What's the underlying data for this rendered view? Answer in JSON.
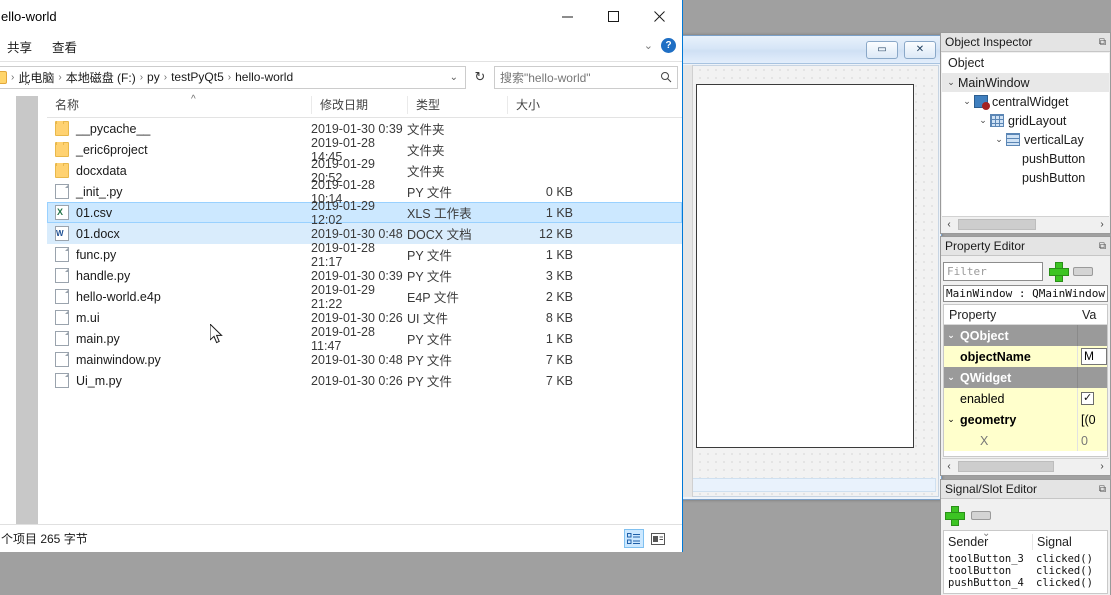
{
  "explorer": {
    "title": "hello-world",
    "title_clipped": "ello-world",
    "window_controls": {
      "minimize": "minimize-icon",
      "maximize": "maximize-icon",
      "close": "close-icon"
    },
    "ribbon_tabs": [
      "共享",
      "查看"
    ],
    "ribbon_expand": "chevron-down-icon",
    "help": "?",
    "address": {
      "breadcrumbs": [
        "此电脑",
        "本地磁盘 (F:)",
        "py",
        "testPyQt5",
        "hello-world"
      ],
      "separator": "›",
      "dropdown": "chevron-down-icon",
      "refresh": "↻"
    },
    "search": {
      "placeholder": "搜索\"hello-world\"",
      "icon": "search-icon"
    },
    "columns": [
      "名称",
      "修改日期",
      "类型",
      "大小"
    ],
    "sort_indicator": "^",
    "files": [
      {
        "name": "__pycache__",
        "icon": "folder",
        "date": "2019-01-30 0:39",
        "type": "文件夹",
        "size": "",
        "state": ""
      },
      {
        "name": "_eric6project",
        "icon": "folder",
        "date": "2019-01-28 14:45",
        "type": "文件夹",
        "size": "",
        "state": ""
      },
      {
        "name": "docxdata",
        "icon": "folder",
        "date": "2019-01-29 20:52",
        "type": "文件夹",
        "size": "",
        "state": ""
      },
      {
        "name": "_init_.py",
        "icon": "file",
        "date": "2019-01-28 10:14",
        "type": "PY 文件",
        "size": "0 KB",
        "state": ""
      },
      {
        "name": "01.csv",
        "icon": "xls",
        "date": "2019-01-29 12:02",
        "type": "XLS 工作表",
        "size": "1 KB",
        "state": "selected"
      },
      {
        "name": "01.docx",
        "icon": "docx",
        "date": "2019-01-30 0:48",
        "type": "DOCX 文档",
        "size": "12 KB",
        "state": "hover"
      },
      {
        "name": "func.py",
        "icon": "file",
        "date": "2019-01-28 21:17",
        "type": "PY 文件",
        "size": "1 KB",
        "state": ""
      },
      {
        "name": "handle.py",
        "icon": "file",
        "date": "2019-01-30 0:39",
        "type": "PY 文件",
        "size": "3 KB",
        "state": ""
      },
      {
        "name": "hello-world.e4p",
        "icon": "file",
        "date": "2019-01-29 21:22",
        "type": "E4P 文件",
        "size": "2 KB",
        "state": ""
      },
      {
        "name": "m.ui",
        "icon": "file",
        "date": "2019-01-30 0:26",
        "type": "UI 文件",
        "size": "8 KB",
        "state": ""
      },
      {
        "name": "main.py",
        "icon": "file",
        "date": "2019-01-28 11:47",
        "type": "PY 文件",
        "size": "1 KB",
        "state": ""
      },
      {
        "name": "mainwindow.py",
        "icon": "file",
        "date": "2019-01-30 0:48",
        "type": "PY 文件",
        "size": "7 KB",
        "state": ""
      },
      {
        "name": "Ui_m.py",
        "icon": "file",
        "date": "2019-01-30 0:26",
        "type": "PY 文件",
        "size": "7 KB",
        "state": ""
      }
    ],
    "status": "个项目  265 字节",
    "view_buttons": [
      "details-view-icon",
      "large-icons-view-icon"
    ]
  },
  "object_inspector": {
    "title": "Object Inspector",
    "float_icon": "float-window-icon",
    "column_header": "Object",
    "nodes": [
      {
        "label": "MainWindow",
        "indent": 0,
        "arrow": "⌄",
        "icon": ""
      },
      {
        "label": "centralWidget",
        "indent": 1,
        "arrow": "⌄",
        "icon": "central-widget-icon"
      },
      {
        "label": "gridLayout",
        "indent": 2,
        "arrow": "⌄",
        "icon": "grid-layout-icon"
      },
      {
        "label": "verticalLay",
        "indent": 3,
        "arrow": "⌄",
        "icon": "vertical-layout-icon"
      },
      {
        "label": "pushButton",
        "indent": 4,
        "arrow": "",
        "icon": ""
      },
      {
        "label": "pushButton",
        "indent": 4,
        "arrow": "",
        "icon": ""
      }
    ]
  },
  "property_editor": {
    "title": "Property Editor",
    "float_icon": "float-window-icon",
    "filter_placeholder": "Filter",
    "add_icon": "add-icon",
    "remove_icon": "remove-icon",
    "object_line": "MainWindow : QMainWindow",
    "columns": [
      "Property",
      "Va"
    ],
    "rows": [
      {
        "label": "QObject",
        "value": "",
        "kind": "group",
        "arrow": "⌄",
        "bold": true
      },
      {
        "label": "objectName",
        "value": "M",
        "kind": "edit",
        "arrow": "",
        "bold": true
      },
      {
        "label": "QWidget",
        "value": "",
        "kind": "group",
        "arrow": "⌄",
        "bold": true
      },
      {
        "label": "enabled",
        "value": "✓",
        "kind": "check",
        "arrow": "",
        "bold": false
      },
      {
        "label": "geometry",
        "value": "[(0",
        "kind": "plain",
        "arrow": "⌄",
        "bold": true
      },
      {
        "label": "X",
        "value": "0",
        "kind": "sub",
        "arrow": "",
        "bold": false
      }
    ]
  },
  "signal_slot_editor": {
    "title": "Signal/Slot Editor",
    "float_icon": "float-window-icon",
    "add_icon": "add-icon",
    "remove_icon": "remove-icon",
    "columns": [
      "Sender",
      "Signal"
    ],
    "rows": [
      {
        "sender": "toolButton_3",
        "signal": "clicked()"
      },
      {
        "sender": "toolButton",
        "signal": "clicked()"
      },
      {
        "sender": "pushButton_4",
        "signal": "clicked()"
      }
    ]
  },
  "designer_form": {
    "minimize_label": "▭",
    "close_label": "✕"
  },
  "colors": {
    "accent": "#0078d7",
    "selection": "#cce8ff",
    "dock_bg": "#f0f0f0",
    "group_row": "#9a9a9a",
    "yellow_row": "#ffffcc",
    "green_plus": "#3cc423"
  }
}
